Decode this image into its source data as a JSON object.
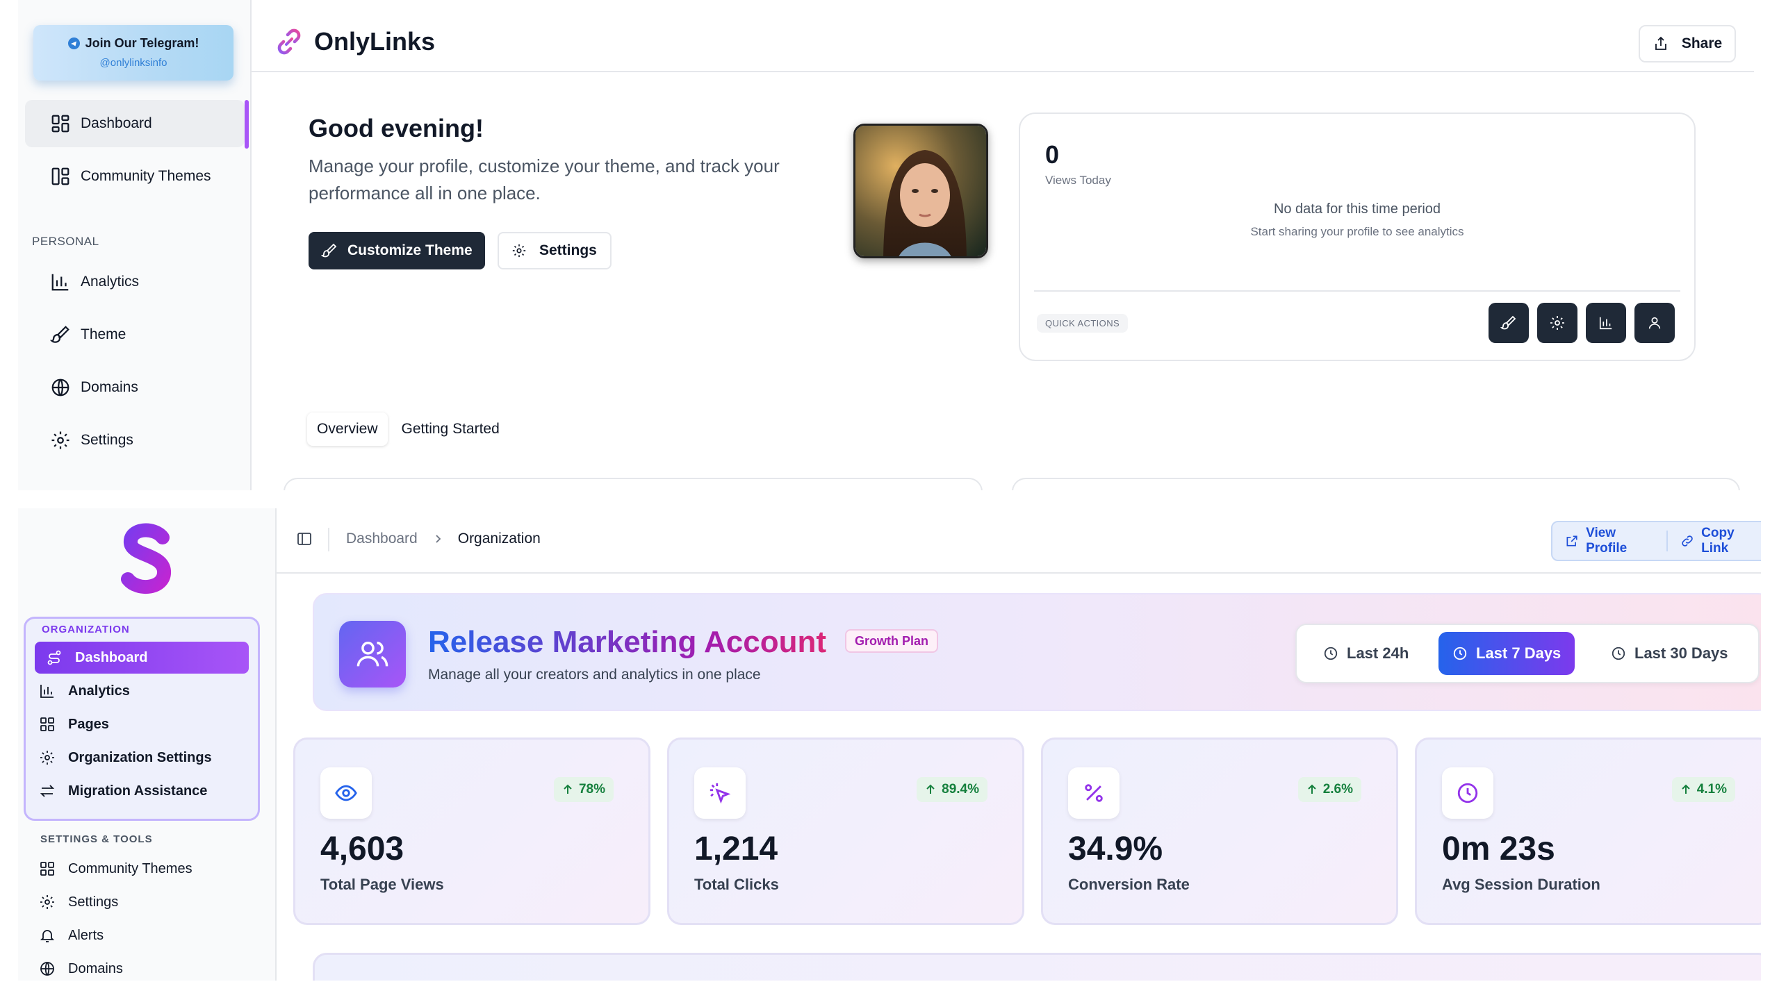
{
  "top": {
    "telegram": {
      "title": "Join Our Telegram!",
      "handle": "@onlylinksinfo"
    },
    "sidebar": {
      "items": [
        {
          "label": "Dashboard",
          "icon": "dashboard-icon"
        },
        {
          "label": "Community Themes",
          "icon": "layout-icon"
        }
      ],
      "section_label": "PERSONAL",
      "personal_items": [
        {
          "label": "Analytics",
          "icon": "bar-chart-icon"
        },
        {
          "label": "Theme",
          "icon": "paintbrush-icon"
        },
        {
          "label": "Domains",
          "icon": "globe-icon"
        },
        {
          "label": "Settings",
          "icon": "gear-icon"
        }
      ]
    },
    "header": {
      "brand": "OnlyLinks",
      "share_label": "Share"
    },
    "greeting": {
      "title": "Good evening!",
      "subtitle": "Manage your profile, customize your theme, and track your performance all in one place.",
      "customize_label": "Customize Theme",
      "settings_label": "Settings"
    },
    "stats": {
      "views": "0",
      "views_label": "Views Today",
      "empty_title": "No data for this time period",
      "empty_sub": "Start sharing your profile to see analytics",
      "quick_actions_label": "QUICK ACTIONS"
    },
    "tabs": [
      "Overview",
      "Getting Started"
    ]
  },
  "bottom": {
    "sidebar": {
      "org_label": "ORGANIZATION",
      "org_items": [
        {
          "label": "Dashboard"
        },
        {
          "label": "Analytics"
        },
        {
          "label": "Pages"
        },
        {
          "label": "Organization Settings"
        },
        {
          "label": "Migration Assistance"
        }
      ],
      "tools_label": "SETTINGS & TOOLS",
      "tools_items": [
        {
          "label": "Community Themes"
        },
        {
          "label": "Settings"
        },
        {
          "label": "Alerts"
        },
        {
          "label": "Domains"
        }
      ]
    },
    "breadcrumb": {
      "parent": "Dashboard",
      "current": "Organization"
    },
    "actions": {
      "view_profile": "View Profile",
      "copy_link": "Copy Link"
    },
    "hero": {
      "title": "Release Marketing Account",
      "badge": "Growth Plan",
      "subtitle": "Manage all your creators and analytics in one place",
      "ranges": [
        "Last 24h",
        "Last 7 Days",
        "Last 30 Days"
      ],
      "active_range": "Last 7 Days"
    },
    "metrics": [
      {
        "value": "4,603",
        "label": "Total Page Views",
        "delta": "78%",
        "icon": "eye-icon",
        "color": "#2563eb"
      },
      {
        "value": "1,214",
        "label": "Total Clicks",
        "delta": "89.4%",
        "icon": "cursor-click-icon",
        "color": "#9333ea"
      },
      {
        "value": "34.9%",
        "label": "Conversion Rate",
        "delta": "2.6%",
        "icon": "percent-icon",
        "color": "#9333ea"
      },
      {
        "value": "0m 23s",
        "label": "Avg Session Duration",
        "delta": "4.1%",
        "icon": "clock-icon",
        "color": "#9333ea"
      }
    ]
  }
}
